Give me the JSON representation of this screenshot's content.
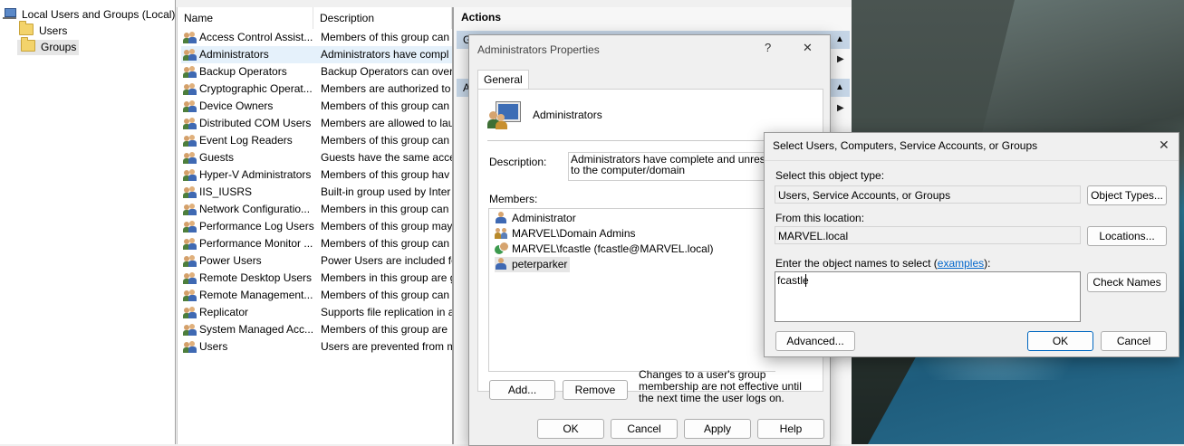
{
  "tree": {
    "root_label": "Local Users and Groups (Local)",
    "items": [
      {
        "label": "Users"
      },
      {
        "label": "Groups"
      }
    ]
  },
  "list": {
    "col_name": "Name",
    "col_description": "Description",
    "rows": [
      {
        "name": "Access Control Assist...",
        "description": "Members of this group can"
      },
      {
        "name": "Administrators",
        "description": "Administrators have compl"
      },
      {
        "name": "Backup Operators",
        "description": "Backup Operators can overr"
      },
      {
        "name": "Cryptographic Operat...",
        "description": "Members are authorized to"
      },
      {
        "name": "Device Owners",
        "description": "Members of this group can"
      },
      {
        "name": "Distributed COM Users",
        "description": "Members are allowed to lau"
      },
      {
        "name": "Event Log Readers",
        "description": "Members of this group can"
      },
      {
        "name": "Guests",
        "description": "Guests have the same acces"
      },
      {
        "name": "Hyper-V Administrators",
        "description": "Members of this group hav"
      },
      {
        "name": "IIS_IUSRS",
        "description": "Built-in group used by Inter"
      },
      {
        "name": "Network Configuratio...",
        "description": "Members in this group can"
      },
      {
        "name": "Performance Log Users",
        "description": "Members of this group may"
      },
      {
        "name": "Performance Monitor ...",
        "description": "Members of this group can"
      },
      {
        "name": "Power Users",
        "description": "Power Users are included fo"
      },
      {
        "name": "Remote Desktop Users",
        "description": "Members in this group are g"
      },
      {
        "name": "Remote Management...",
        "description": "Members of this group can"
      },
      {
        "name": "Replicator",
        "description": "Supports file replication in a"
      },
      {
        "name": "System Managed Acc...",
        "description": "Members of this group are"
      },
      {
        "name": "Users",
        "description": "Users are prevented from m"
      }
    ]
  },
  "actions": {
    "title": "Actions",
    "bar1_label": "G",
    "bar2_label": "A"
  },
  "props_dialog": {
    "title": "Administrators Properties",
    "help_glyph": "?",
    "close_glyph": "✕",
    "tab_general": "General",
    "group_name": "Administrators",
    "description_label": "Description:",
    "description_value": "Administrators have complete and unrestricted\nto the computer/domain",
    "members_label": "Members:",
    "members": [
      {
        "name": "Administrator",
        "icon": "user-icon"
      },
      {
        "name": "MARVEL\\Domain Admins",
        "icon": "group-icon"
      },
      {
        "name": "MARVEL\\fcastle (fcastle@MARVEL.local)",
        "icon": "domain-user-icon"
      },
      {
        "name": "peterparker",
        "icon": "user-icon"
      }
    ],
    "add_button": "Add...",
    "remove_button": "Remove",
    "note": "Changes to a user's group membership are not effective until the next time the user logs on.",
    "ok_button": "OK",
    "cancel_button": "Cancel",
    "apply_button": "Apply",
    "help_button": "Help"
  },
  "select_dialog": {
    "title": "Select Users, Computers, Service Accounts, or Groups",
    "close_glyph": "✕",
    "object_type_label": "Select this object type:",
    "object_type_value": "Users, Service Accounts, or Groups",
    "object_types_button": "Object Types...",
    "location_label": "From this location:",
    "location_value": "MARVEL.local",
    "locations_button": "Locations...",
    "names_label_prefix": "Enter the object names to select (",
    "names_label_link": "examples",
    "names_label_suffix": "):",
    "names_value": "fcastle",
    "check_names_button": "Check Names",
    "advanced_button": "Advanced...",
    "ok_button": "OK",
    "cancel_button": "Cancel"
  }
}
